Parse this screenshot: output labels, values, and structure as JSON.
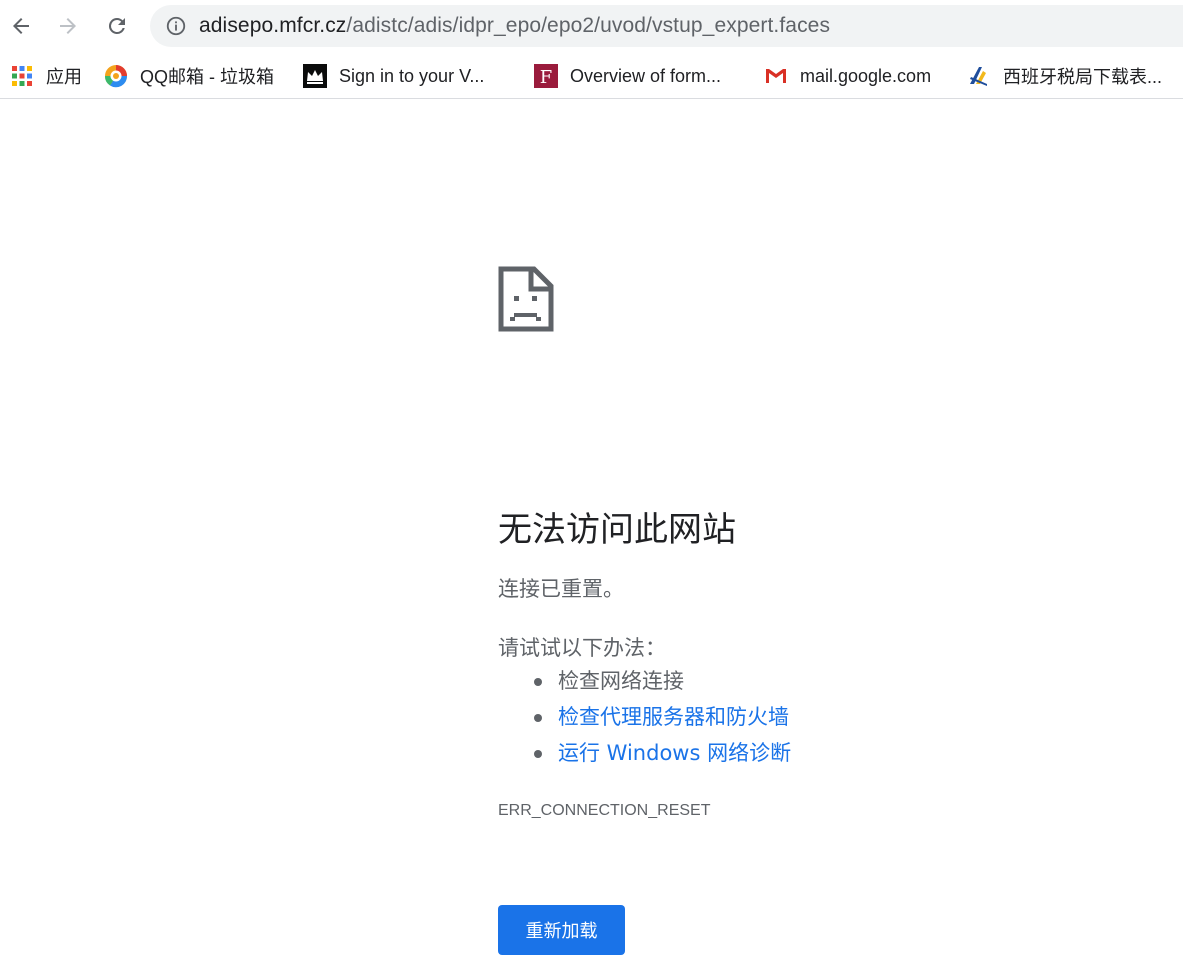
{
  "browser": {
    "url_host": "adisepo.mfcr.cz",
    "url_path": "/adistc/adis/idpr_epo/epo2/uvod/vstup_expert.faces"
  },
  "bookmarks": [
    {
      "label": "应用",
      "icon": "apps-grid-icon"
    },
    {
      "label": "QQ邮箱 - 垃圾箱",
      "icon": "qq-mail-icon"
    },
    {
      "label": "Sign in to your V...",
      "icon": "crown-icon"
    },
    {
      "label": "Overview of form...",
      "icon": "f-logo-icon"
    },
    {
      "label": "mail.google.com",
      "icon": "gmail-icon"
    },
    {
      "label": "西班牙税局下载表...",
      "icon": "spain-tax-icon"
    }
  ],
  "error": {
    "heading": "无法访问此网站",
    "subtext": "连接已重置。",
    "try_label": "请试试以下办法：",
    "suggestions": [
      "检查网络连接",
      "检查代理服务器和防火墙",
      "运行 Windows 网络诊断"
    ],
    "code": "ERR_CONNECTION_RESET",
    "reload_label": "重新加载"
  },
  "colors": {
    "link": "#1a73e8",
    "button_bg": "#1a73e8",
    "text_secondary": "#5f6368",
    "omnibox_bg": "#f1f3f4"
  }
}
